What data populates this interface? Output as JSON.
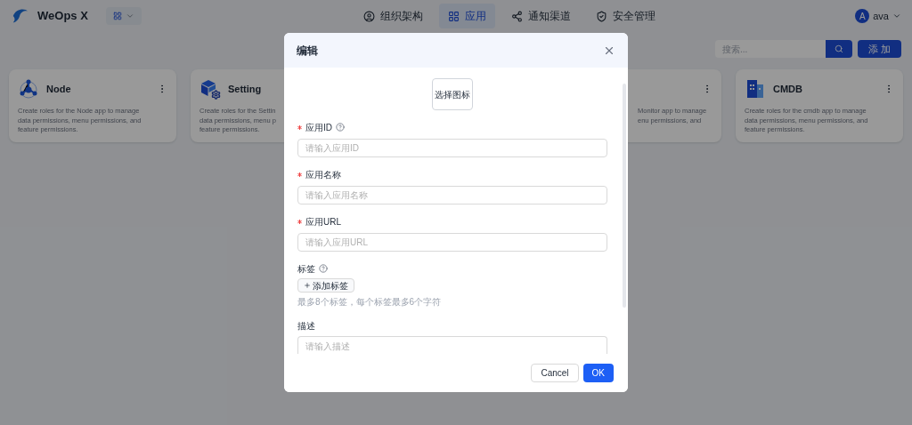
{
  "header": {
    "brand": "WeOps X",
    "nav": [
      {
        "label": "组织架构",
        "selected": false
      },
      {
        "label": "应用",
        "selected": true
      },
      {
        "label": "通知渠道",
        "selected": false
      },
      {
        "label": "安全管理",
        "selected": false
      }
    ],
    "user": {
      "initial": "A",
      "name": "ava"
    }
  },
  "toolbar": {
    "search_placeholder": "搜索...",
    "add_button": "添 加"
  },
  "cards": [
    {
      "kind": "node",
      "title": "Node",
      "lines": [
        "Create roles for the Node app to manage",
        "data permissions, menu permissions, and",
        "feature permissions."
      ]
    },
    {
      "kind": "setting",
      "title": "Setting",
      "lines": [
        "Create roles for the Settin",
        "data permissions, menu p",
        "feature permissions."
      ]
    },
    {
      "kind": "hidden"
    },
    {
      "kind": "partial",
      "lines": [
        "Monitor app to manage",
        "enu permissions, and"
      ]
    },
    {
      "kind": "cmdb",
      "title": "CMDB",
      "lines": [
        "Create roles for the cmdb app to manage",
        "data permissions, menu permissions, and",
        "feature permissions."
      ]
    }
  ],
  "modal": {
    "title": "编辑",
    "icon_picker": "选择图标",
    "fields": [
      {
        "kind": "input",
        "label": "应用ID",
        "required": true,
        "help": true,
        "placeholder": "请输入应用ID"
      },
      {
        "kind": "input",
        "label": "应用名称",
        "required": true,
        "help": false,
        "placeholder": "请输入应用名称"
      },
      {
        "kind": "input",
        "label": "应用URL",
        "required": true,
        "help": false,
        "placeholder": "请输入应用URL"
      },
      {
        "kind": "tags",
        "label": "标签",
        "required": false,
        "help": true,
        "button": "添加标签",
        "hint": "最多8个标签，每个标签最多6个字符"
      },
      {
        "kind": "textarea",
        "label": "描述",
        "required": false,
        "help": false,
        "placeholder": "请输入描述"
      }
    ],
    "cancel": "Cancel",
    "ok": "OK"
  }
}
